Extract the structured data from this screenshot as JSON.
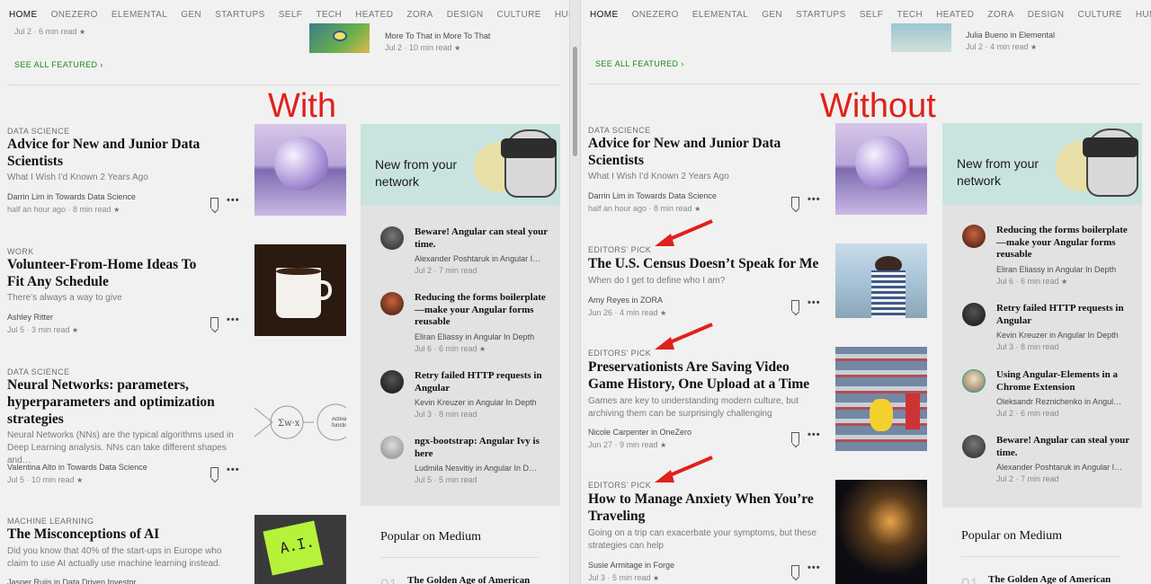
{
  "nav": [
    "HOME",
    "ONEZERO",
    "ELEMENTAL",
    "GEN",
    "STARTUPS",
    "SELF",
    "TECH",
    "HEATED",
    "ZORA",
    "DESIGN",
    "CULTURE",
    "HUMAN PARTS"
  ],
  "left": {
    "annotation": "With",
    "top_meta_left": "Jul 2 · 6 min read",
    "top_featured_title": "More To That in More To That",
    "top_featured_meta": "Jul 2 · 10 min read",
    "see_all": "SEE ALL FEATURED",
    "articles": [
      {
        "category": "DATA SCIENCE",
        "title": "Advice for New and Junior Data Scientists",
        "subtitle": "What I Wish I’d Known 2 Years Ago",
        "author": "Darrin Lim in Towards Data Science",
        "date": "half an hour ago · 8 min read"
      },
      {
        "category": "WORK",
        "title": "Volunteer-From-Home Ideas To Fit Any Schedule",
        "subtitle": "There’s always a way to give",
        "author": "Ashley Ritter",
        "date": "Jul 5 · 3 min read"
      },
      {
        "category": "DATA SCIENCE",
        "title": "Neural Networks: parameters, hyperparameters and optimization strategies",
        "subtitle": "Neural Networks (NNs) are the typical algorithms used in Deep Learning analysis. NNs can take different shapes and…",
        "author": "Valentina Alto in Towards Data Science",
        "date": "Jul 5 · 10 min read"
      },
      {
        "category": "MACHINE LEARNING",
        "title": "The Misconceptions of AI",
        "subtitle": "Did you know that 40% of the start-ups in Europe who claim to use AI actually use machine learning instead.",
        "author": "Jasper Ruijs in Data Driven Investor",
        "date": ""
      }
    ],
    "network_title": "New from your network",
    "network": [
      {
        "title": "Beware! Angular can steal your time.",
        "author": "Alexander Poshtaruk in Angular I…",
        "date": "Jul 2 · 7 min read"
      },
      {
        "title": "Reducing the forms boilerplate—make your Angular forms reusable",
        "author": "Eliran Eliassy in Angular In Depth",
        "date": "Jul 6 · 6 min read"
      },
      {
        "title": "Retry failed HTTP requests in Angular",
        "author": "Kevin Kreuzer in Angular In Depth",
        "date": "Jul 3 · 8 min read"
      },
      {
        "title": "ngx-bootstrap: Angular Ivy is here",
        "author": "Ludmila Nesvitiy in Angular In D…",
        "date": "Jul 5 · 5 min read"
      }
    ],
    "popular_title": "Popular on Medium",
    "popular_first": "The Golden Age of American",
    "popular_num": "01",
    "nn_node_label": "Activation function"
  },
  "right": {
    "annotation": "Without",
    "top_featured_title": "Julia Bueno in Elemental",
    "top_featured_meta": "Jul 2 · 4 min read",
    "see_all": "SEE ALL FEATURED",
    "articles": [
      {
        "category": "DATA SCIENCE",
        "title": "Advice for New and Junior Data Scientists",
        "subtitle": "What I Wish I’d Known 2 Years Ago",
        "author": "Darrin Lim in Towards Data Science",
        "date": "half an hour ago · 8 min read"
      },
      {
        "category": "EDITORS’ PICK",
        "title": "The U.S. Census Doesn’t Speak for Me",
        "subtitle": "When do I get to define who I am?",
        "author": "Amy Reyes in ZORA",
        "date": "Jun 26 · 4 min read"
      },
      {
        "category": "EDITORS’ PICK",
        "title": "Preservationists Are Saving Video Game History, One Upload at a Time",
        "subtitle": "Games are key to understanding modern culture, but archiving them can be surprisingly challenging",
        "author": "Nicole Carpenter in OneZero",
        "date": "Jun 27 · 9 min read"
      },
      {
        "category": "EDITORS’ PICK",
        "title": "How to Manage Anxiety When You’re Traveling",
        "subtitle": "Going on a trip can exacerbate your symptoms, but these strategies can help",
        "author": "Susie Armitage in Forge",
        "date": "Jul 3 · 5 min read"
      }
    ],
    "network_title": "New from your network",
    "network": [
      {
        "title": "Reducing the forms boilerplate—make your Angular forms reusable",
        "author": "Eliran Eliassy in Angular In Depth",
        "date": "Jul 6 · 6 min read"
      },
      {
        "title": "Retry failed HTTP requests in Angular",
        "author": "Kevin Kreuzer in Angular In Depth",
        "date": "Jul 3 · 8 min read"
      },
      {
        "title": "Using Angular-Elements in a Chrome Extension",
        "author": "Oleksandr Reznichenko in Angul…",
        "date": "Jul 2 · 6 min read"
      },
      {
        "title": "Beware! Angular can steal your time.",
        "author": "Alexander Poshtaruk in Angular I…",
        "date": "Jul 2 · 7 min read"
      }
    ],
    "popular_title": "Popular on Medium",
    "popular_first": "The Golden Age of American",
    "popular_num": "01"
  },
  "star_glyph": "★",
  "see_all_chevron": "›",
  "more_glyph": "•••",
  "colors": {
    "annotation": "#e0211b",
    "accent_green": "#1a8917",
    "network_header": "#c9e3df"
  }
}
